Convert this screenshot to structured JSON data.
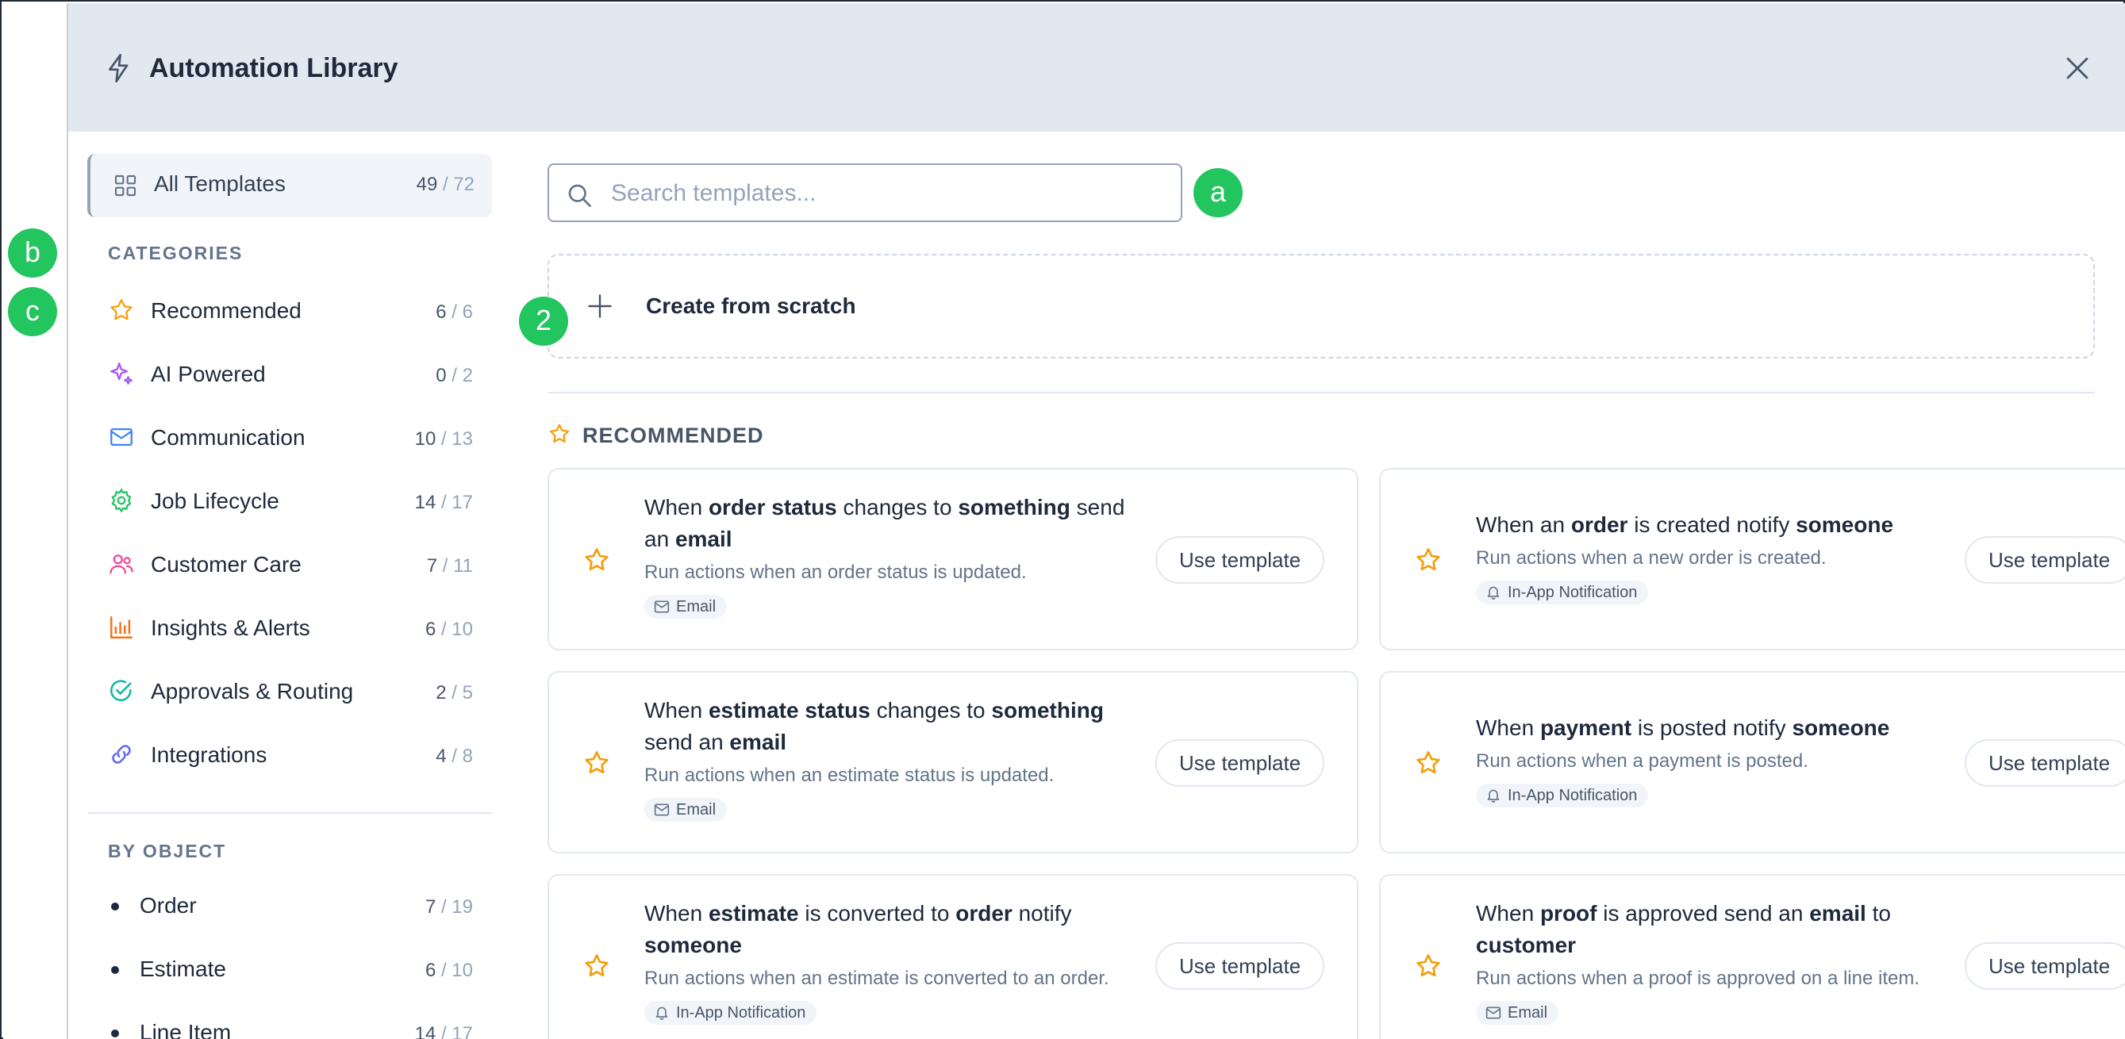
{
  "header": {
    "title": "Automation Library"
  },
  "markers": {
    "a": "a",
    "b": "b",
    "c": "c",
    "two": "2"
  },
  "sidebar": {
    "all_templates": {
      "label": "All Templates",
      "count": "49",
      "total": " / 72"
    },
    "categories_title": "CATEGORIES",
    "categories": [
      {
        "label": "Recommended",
        "count": "6",
        "total": " / 6",
        "icon": "star-icon",
        "color": "#f59e0b"
      },
      {
        "label": "AI Powered",
        "count": "0",
        "total": " / 2",
        "icon": "sparkle-icon",
        "color": "#a855f7"
      },
      {
        "label": "Communication",
        "count": "10",
        "total": " / 13",
        "icon": "mail-icon",
        "color": "#3b82f6"
      },
      {
        "label": "Job Lifecycle",
        "count": "14",
        "total": " / 17",
        "icon": "gear-icon",
        "color": "#22c55e"
      },
      {
        "label": "Customer Care",
        "count": "7",
        "total": " / 11",
        "icon": "users-icon",
        "color": "#ec4899"
      },
      {
        "label": "Insights & Alerts",
        "count": "6",
        "total": " / 10",
        "icon": "chart-icon",
        "color": "#f97316"
      },
      {
        "label": "Approvals & Routing",
        "count": "2",
        "total": " / 5",
        "icon": "check-circle-icon",
        "color": "#14b8a6"
      },
      {
        "label": "Integrations",
        "count": "4",
        "total": " / 8",
        "icon": "link-icon",
        "color": "#6366f1"
      }
    ],
    "by_object_title": "BY OBJECT",
    "objects": [
      {
        "label": "Order",
        "count": "7",
        "total": " / 19"
      },
      {
        "label": "Estimate",
        "count": "6",
        "total": " / 10"
      },
      {
        "label": "Line Item",
        "count": "14",
        "total": " / 17"
      }
    ]
  },
  "search": {
    "placeholder": "Search templates..."
  },
  "create": {
    "label": "Create from scratch"
  },
  "recommended": {
    "title": "RECOMMENDED"
  },
  "cards": [
    {
      "title_parts": [
        [
          "When ",
          0
        ],
        [
          "order status",
          1
        ],
        [
          " changes to ",
          0
        ],
        [
          "something",
          1
        ],
        [
          " send an ",
          0
        ],
        [
          "email",
          1
        ]
      ],
      "desc": "Run actions when an order status is updated.",
      "badge": "Email",
      "badge_icon": "mail-icon",
      "button": "Use template"
    },
    {
      "title_parts": [
        [
          "When an ",
          0
        ],
        [
          "order",
          1
        ],
        [
          " is created notify ",
          0
        ],
        [
          "someone",
          1
        ]
      ],
      "desc": "Run actions when a new order is created.",
      "badge": "In-App Notification",
      "badge_icon": "bell-icon",
      "button": "Use template"
    },
    {
      "title_parts": [
        [
          "When ",
          0
        ],
        [
          "estimate status",
          1
        ],
        [
          " changes to ",
          0
        ],
        [
          "something",
          1
        ],
        [
          " send an ",
          0
        ],
        [
          "email",
          1
        ]
      ],
      "desc": "Run actions when an estimate status is updated.",
      "badge": "Email",
      "badge_icon": "mail-icon",
      "button": "Use template"
    },
    {
      "title_parts": [
        [
          "When ",
          0
        ],
        [
          "payment",
          1
        ],
        [
          " is posted notify ",
          0
        ],
        [
          "someone",
          1
        ]
      ],
      "desc": "Run actions when a payment is posted.",
      "badge": "In-App Notification",
      "badge_icon": "bell-icon",
      "button": "Use template"
    },
    {
      "title_parts": [
        [
          "When ",
          0
        ],
        [
          "estimate",
          1
        ],
        [
          " is converted to ",
          0
        ],
        [
          "order",
          1
        ],
        [
          " notify ",
          0
        ],
        [
          "someone",
          1
        ]
      ],
      "desc": "Run actions when an estimate is converted to an order.",
      "badge": "In-App Notification",
      "badge_icon": "bell-icon",
      "button": "Use template"
    },
    {
      "title_parts": [
        [
          "When ",
          0
        ],
        [
          "proof",
          1
        ],
        [
          " is approved send an ",
          0
        ],
        [
          "email",
          1
        ],
        [
          " to ",
          0
        ],
        [
          "customer",
          1
        ]
      ],
      "desc": "Run actions when a proof is approved on a line item.",
      "badge": "Email",
      "badge_icon": "mail-icon",
      "button": "Use template"
    }
  ]
}
